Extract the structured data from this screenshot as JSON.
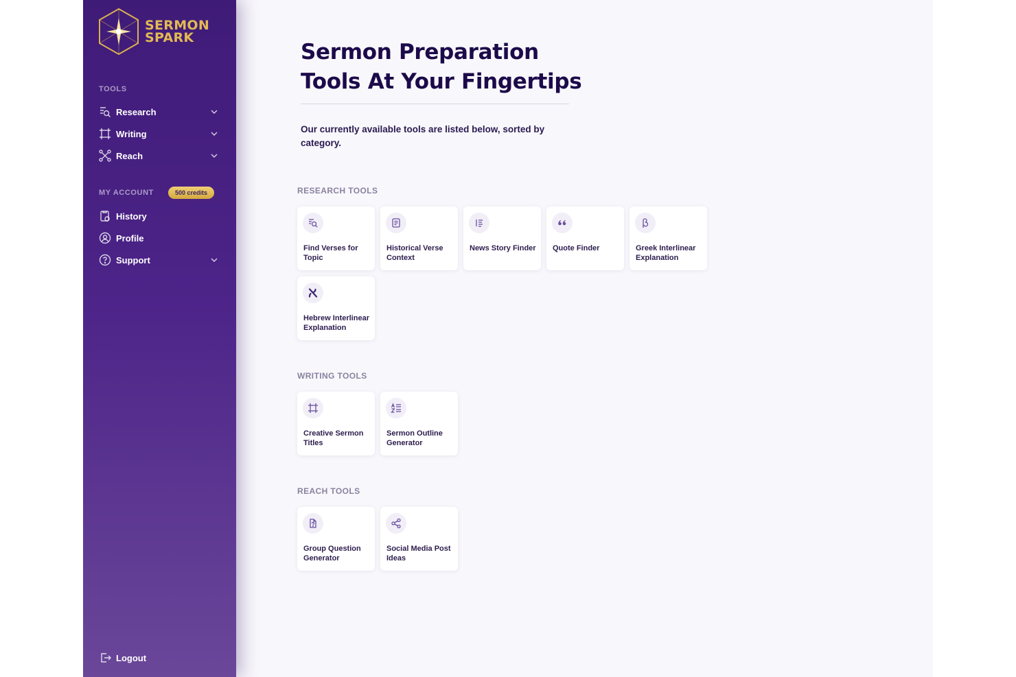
{
  "app": {
    "logo_line1": "SERMON",
    "logo_line2": "SPARK",
    "accent_color": "#e3b953",
    "sidebar_color": "#4a2285"
  },
  "sidebar": {
    "tools_label": "TOOLS",
    "tools": [
      {
        "label": "Research",
        "icon": "search-list-icon",
        "expandable": true
      },
      {
        "label": "Writing",
        "icon": "frame-icon",
        "expandable": true
      },
      {
        "label": "Reach",
        "icon": "network-icon",
        "expandable": true
      }
    ],
    "account_label": "MY ACCOUNT",
    "credits_badge": "500 credits",
    "account": [
      {
        "label": "History",
        "icon": "history-icon",
        "expandable": false
      },
      {
        "label": "Profile",
        "icon": "profile-icon",
        "expandable": false
      },
      {
        "label": "Support",
        "icon": "help-icon",
        "expandable": true
      }
    ],
    "logout_label": "Logout"
  },
  "main": {
    "title_line1": "Sermon Preparation",
    "title_line2": "Tools At Your Fingertips",
    "intro": "Our currently available tools are listed below, sorted by category.",
    "categories": [
      {
        "label": "RESEARCH TOOLS",
        "tools": [
          {
            "name": "Find Verses for Topic",
            "icon": "search-list-icon"
          },
          {
            "name": "Historical Verse Context",
            "icon": "document-icon"
          },
          {
            "name": "News Story Finder",
            "icon": "list-icon"
          },
          {
            "name": "Quote Finder",
            "icon": "quote-icon"
          },
          {
            "name": "Greek Interlinear Explanation",
            "icon": "beta-icon"
          },
          {
            "name": "Hebrew Interlinear Explanation",
            "icon": "aleph-icon"
          }
        ]
      },
      {
        "label": "WRITING TOOLS",
        "tools": [
          {
            "name": "Creative Sermon Titles",
            "icon": "frame-icon"
          },
          {
            "name": "Sermon Outline Generator",
            "icon": "sort-alpha-icon"
          }
        ]
      },
      {
        "label": "REACH TOOLS",
        "tools": [
          {
            "name": "Group Question Generator",
            "icon": "file-question-icon"
          },
          {
            "name": "Social Media Post Ideas",
            "icon": "share-icon"
          }
        ]
      }
    ]
  }
}
